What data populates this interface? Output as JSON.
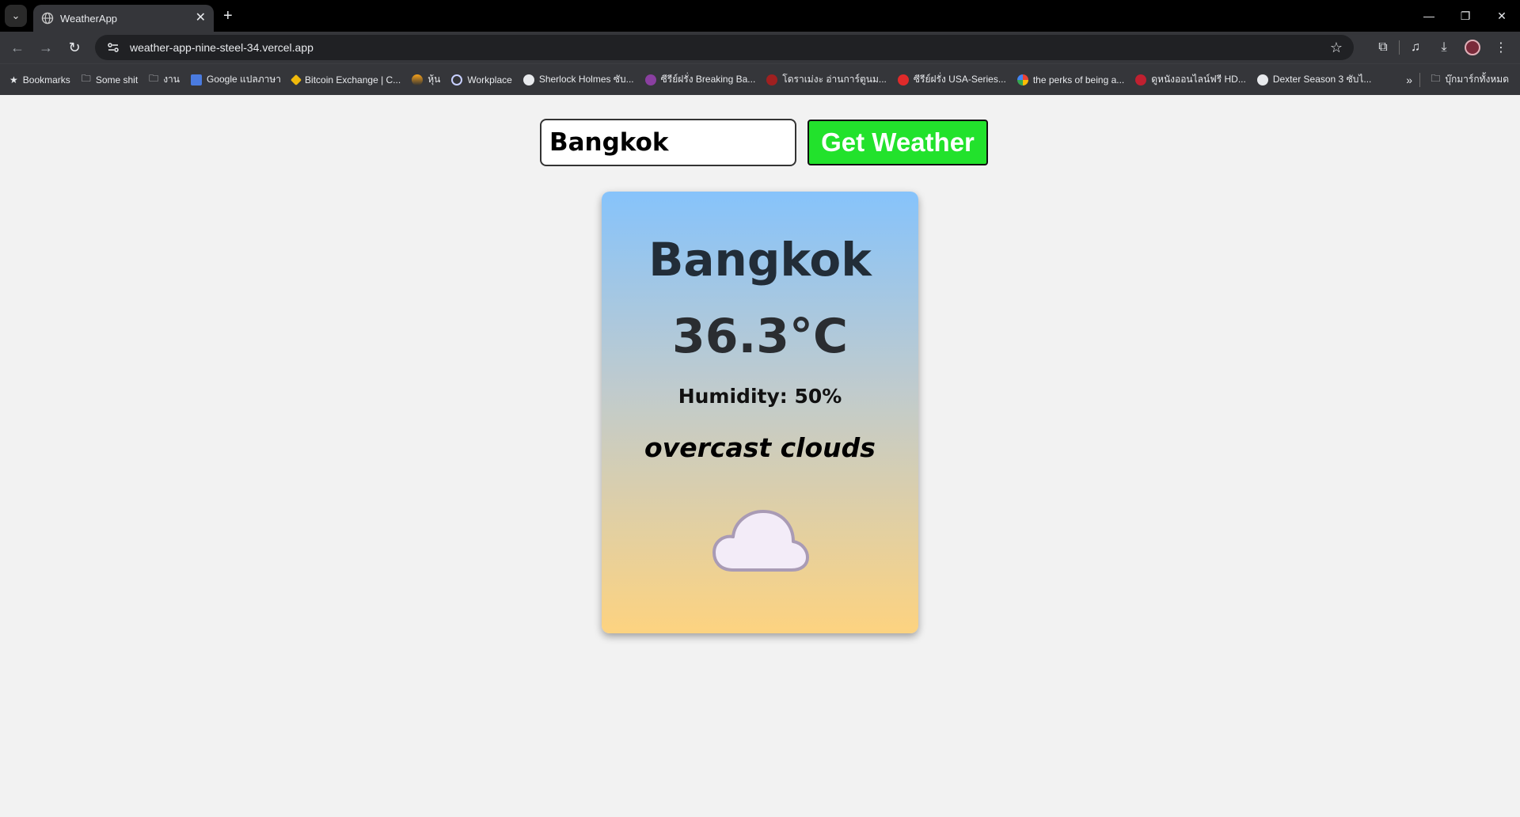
{
  "browser": {
    "tab_title": "WeatherApp",
    "url": "weather-app-nine-steel-34.vercel.app",
    "bookmarks": [
      {
        "label": "Bookmarks",
        "icon": "star-icon"
      },
      {
        "label": "Some shit",
        "icon": "folder-icon"
      },
      {
        "label": "งาน",
        "icon": "folder-icon"
      },
      {
        "label": "Google แปลภาษา",
        "icon": "translate-icon"
      },
      {
        "label": "Bitcoin Exchange | C...",
        "icon": "binance-icon"
      },
      {
        "label": "หุ้น",
        "icon": "stock-icon"
      },
      {
        "label": "Workplace",
        "icon": "workplace-icon"
      },
      {
        "label": "Sherlock Holmes ซับ...",
        "icon": "globe-icon"
      },
      {
        "label": "ซีรีย์ฝรั่ง Breaking Ba...",
        "icon": "site-icon"
      },
      {
        "label": "โดราเม่งะ อ่านการ์ตูนม...",
        "icon": "site-icon"
      },
      {
        "label": "ซีรีย์ฝรั่ง USA-Series...",
        "icon": "site-icon"
      },
      {
        "label": "the perks of being a...",
        "icon": "google-icon"
      },
      {
        "label": "ดูหนังออนไลน์ฟรี HD...",
        "icon": "site-icon"
      },
      {
        "label": "Dexter Season 3 ซับไ...",
        "icon": "globe-icon"
      }
    ],
    "all_bookmarks_label": "บุ๊กมาร์กทั้งหมด"
  },
  "search": {
    "value": "Bangkok",
    "button_label": "Get Weather"
  },
  "weather": {
    "city": "Bangkok",
    "temperature": "36.3°C",
    "humidity": "Humidity: 50%",
    "description": "overcast clouds",
    "icon": "cloud-icon"
  },
  "colors": {
    "button": "#22e22c",
    "card_top": "#86c3fb",
    "card_bottom": "#fdd380"
  }
}
